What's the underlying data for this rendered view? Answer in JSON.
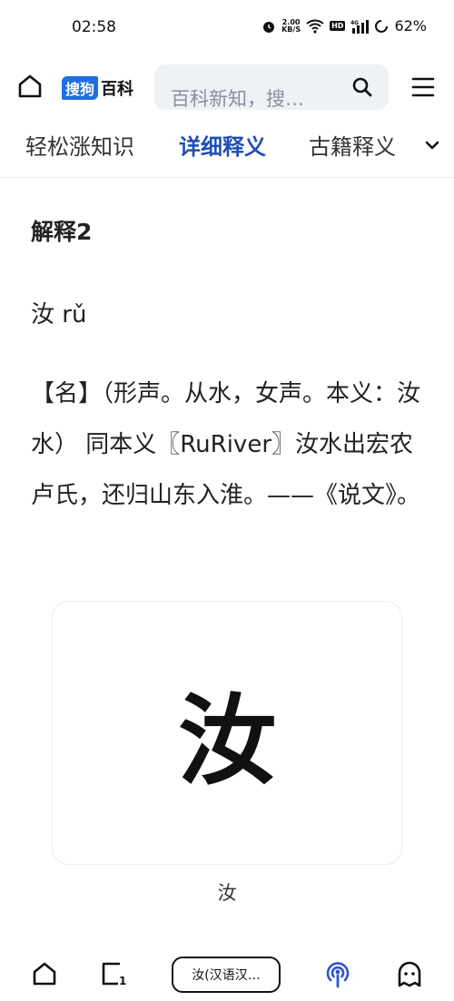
{
  "status_bar": {
    "time": "02:58",
    "net_speed_value": "2.00",
    "net_speed_unit": "KB/S",
    "hd_label": "HD",
    "network_label": "4G",
    "battery": "62%"
  },
  "header": {
    "logo_badge": "搜狗",
    "logo_text": "百科",
    "search_placeholder": "百科新知，搜…",
    "icons": [
      "home-icon",
      "search-icon",
      "menu-icon"
    ]
  },
  "tabs": [
    {
      "label": "轻松涨知识",
      "active": false
    },
    {
      "label": "详细释义",
      "active": true
    },
    {
      "label": "古籍释义",
      "active": false
    }
  ],
  "content": {
    "section_title": "解释2",
    "pinyin_line": "汝 rǔ",
    "definition": "【名】（形声。从水，女声。本义：汝水） 同本义〖RuRiver〗汝水出宏农卢氏，还归山东入淮。——《说文》。",
    "image_char": "汝",
    "image_caption": "汝"
  },
  "bottom_nav": {
    "pill_label": "汝(汉语汉…",
    "accent_color": "#2f55d4",
    "icons": [
      "home-icon",
      "tabs-icon",
      "podcast-icon",
      "profile-icon"
    ]
  }
}
